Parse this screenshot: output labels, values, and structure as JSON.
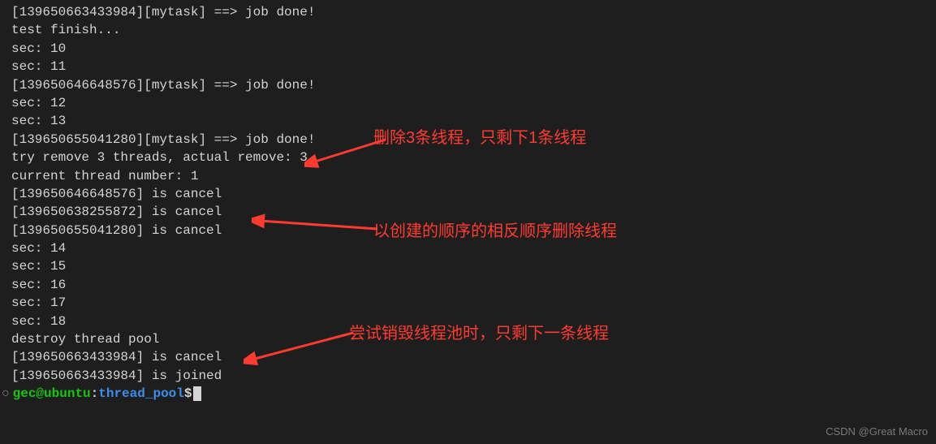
{
  "terminal": {
    "lines": [
      "[139650663433984][mytask] ==> job done!",
      "test finish...",
      "sec: 10",
      "sec: 11",
      "[139650646648576][mytask] ==> job done!",
      "sec: 12",
      "sec: 13",
      "[139650655041280][mytask] ==> job done!",
      "try remove 3 threads, actual remove: 3",
      "current thread number: 1",
      "[139650646648576] is cancel",
      "[139650638255872] is cancel",
      "[139650655041280] is cancel",
      "sec: 14",
      "sec: 15",
      "sec: 16",
      "sec: 17",
      "sec: 18",
      "destroy thread pool",
      "[139650663433984] is cancel",
      "[139650663433984] is joined"
    ],
    "prompt": {
      "user": "gec",
      "at": "@",
      "host": "ubuntu",
      "colon": ":",
      "path": "thread_pool",
      "end": "$"
    }
  },
  "annotations": {
    "note1": "删除3条线程，只剩下1条线程",
    "note2": "以创建的顺序的相反顺序删除线程",
    "note3": "尝试销毁线程池时，只剩下一条线程"
  },
  "watermark": "CSDN @Great Macro",
  "colors": {
    "bg": "#1e1e1e",
    "fg": "#d4d4d4",
    "green": "#16c60c",
    "blue": "#3b8eea",
    "red": "#ff3b30"
  }
}
